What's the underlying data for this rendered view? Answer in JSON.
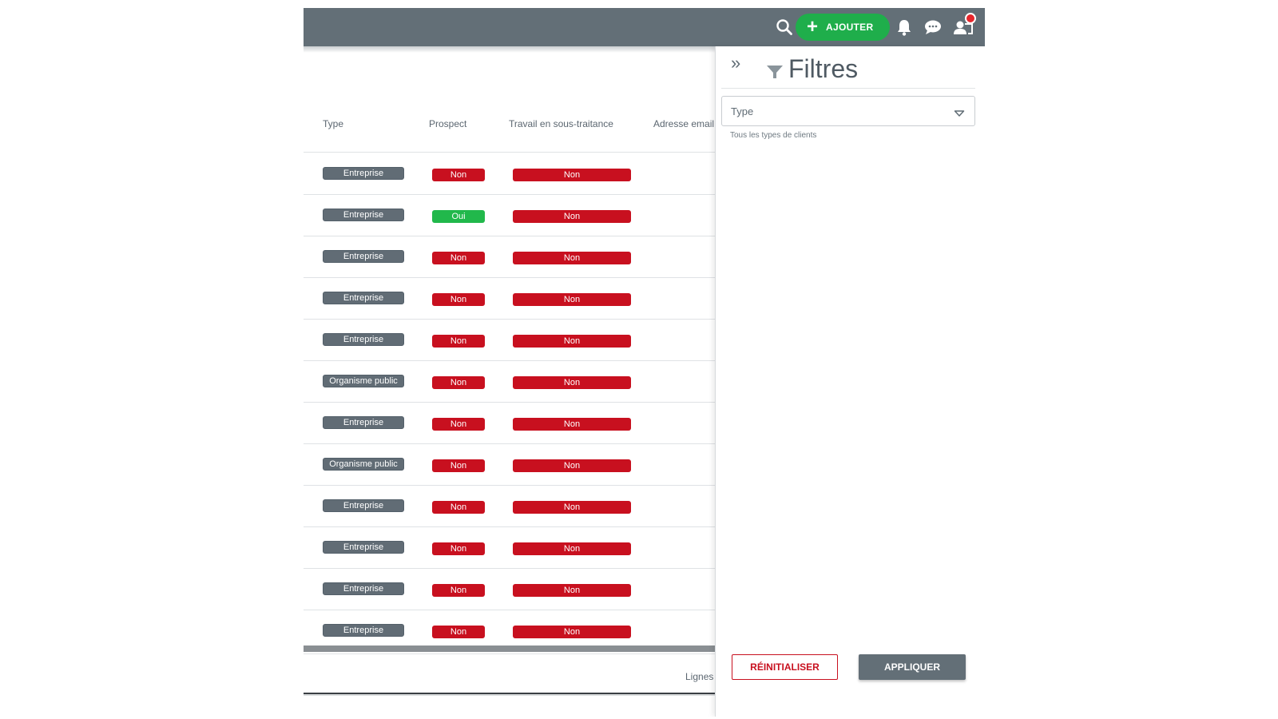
{
  "topbar": {
    "add_label": "AJOUTER",
    "icons": [
      "search-icon",
      "plus-icon",
      "bell-icon",
      "chat-icon",
      "user-switch-icon"
    ],
    "notification_color": "#e6262c"
  },
  "table": {
    "headers": {
      "type": "Type",
      "prospect": "Prospect",
      "sous_traitance": "Travail en sous-traitance",
      "email": "Adresse email"
    },
    "rows": [
      {
        "type": "Entreprise",
        "prospect": "Non",
        "sous_traitance": "Non"
      },
      {
        "type": "Entreprise",
        "prospect": "Oui",
        "sous_traitance": "Non"
      },
      {
        "type": "Entreprise",
        "prospect": "Non",
        "sous_traitance": "Non"
      },
      {
        "type": "Entreprise",
        "prospect": "Non",
        "sous_traitance": "Non"
      },
      {
        "type": "Entreprise",
        "prospect": "Non",
        "sous_traitance": "Non"
      },
      {
        "type": "Organisme public",
        "prospect": "Non",
        "sous_traitance": "Non"
      },
      {
        "type": "Entreprise",
        "prospect": "Non",
        "sous_traitance": "Non"
      },
      {
        "type": "Organisme public",
        "prospect": "Non",
        "sous_traitance": "Non"
      },
      {
        "type": "Entreprise",
        "prospect": "Non",
        "sous_traitance": "Non"
      },
      {
        "type": "Entreprise",
        "prospect": "Non",
        "sous_traitance": "Non"
      },
      {
        "type": "Entreprise",
        "prospect": "Non",
        "sous_traitance": "Non"
      },
      {
        "type": "Entreprise",
        "prospect": "Non",
        "sous_traitance": "Non"
      }
    ],
    "footer_label": "Lignes",
    "colors": {
      "oui": "#21b84b",
      "non": "#c8101f",
      "type": "#616c75"
    }
  },
  "filters": {
    "title": "Filtres",
    "type_select": {
      "label": "Type",
      "helper": "Tous les types de clients"
    },
    "reset_label": "RÉINITIALISER",
    "apply_label": "APPLIQUER"
  },
  "colors": {
    "topbar": "#636f77",
    "accent_green": "#1fae4b",
    "danger_red": "#c8101f"
  }
}
